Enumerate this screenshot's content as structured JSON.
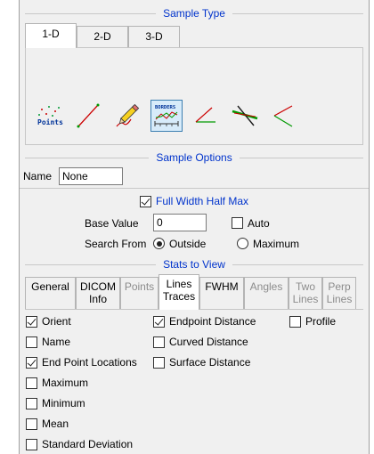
{
  "sample_type": {
    "title": "Sample Type",
    "tabs": [
      {
        "label": "1-D",
        "active": true
      },
      {
        "label": "2-D",
        "active": false
      },
      {
        "label": "3-D",
        "active": false
      }
    ],
    "tools": [
      {
        "name": "points-tool-icon",
        "label": "Points"
      },
      {
        "name": "line-tool-icon"
      },
      {
        "name": "freehand-pencil-tool-icon"
      },
      {
        "name": "borders-tool-icon",
        "label": "BORDERS",
        "selected": true
      },
      {
        "name": "angle-tool-icon"
      },
      {
        "name": "crossing-lines-tool-icon"
      },
      {
        "name": "open-angle-tool-icon"
      }
    ]
  },
  "sample_options": {
    "title": "Sample Options",
    "name_label": "Name",
    "name_value": "None",
    "fwhm_label": "Full Width Half Max",
    "fwhm_checked": true,
    "base_value_label": "Base Value",
    "base_value": "0",
    "auto_label": "Auto",
    "auto_checked": false,
    "search_from_label": "Search From",
    "search_options": [
      {
        "label": "Outside",
        "checked": true
      },
      {
        "label": "Maximum",
        "checked": false
      }
    ]
  },
  "stats": {
    "title": "Stats to View",
    "tabs": [
      {
        "label": "General",
        "line2": "",
        "state": "normal"
      },
      {
        "label": "DICOM",
        "line2": "Info",
        "state": "normal"
      },
      {
        "label": "Points",
        "line2": "",
        "state": "disabled"
      },
      {
        "label": "Lines",
        "line2": "Traces",
        "state": "active"
      },
      {
        "label": "FWHM",
        "line2": "",
        "state": "normal"
      },
      {
        "label": "Angles",
        "line2": "",
        "state": "disabled"
      },
      {
        "label": "Two",
        "line2": "Lines",
        "state": "disabled"
      },
      {
        "label": "Perp",
        "line2": "Lines",
        "state": "disabled"
      }
    ],
    "options": {
      "col1": [
        {
          "label": "Orient",
          "checked": true
        },
        {
          "label": "Name",
          "checked": false
        },
        {
          "label": "End Point Locations",
          "checked": true
        },
        {
          "label": "Maximum",
          "checked": false
        },
        {
          "label": "Minimum",
          "checked": false
        },
        {
          "label": "Mean",
          "checked": false
        },
        {
          "label": "Standard Deviation",
          "checked": false
        }
      ],
      "col2": [
        {
          "label": "Endpoint Distance",
          "checked": true
        },
        {
          "label": "Curved Distance",
          "checked": false
        },
        {
          "label": "Surface Distance",
          "checked": false
        }
      ],
      "col3": [
        {
          "label": "Profile",
          "checked": false
        }
      ]
    }
  },
  "colors": {
    "section_title": "#0033cc",
    "panel_bg": "#f0f0f0",
    "selected_tool_bg": "#d7ebfa"
  }
}
